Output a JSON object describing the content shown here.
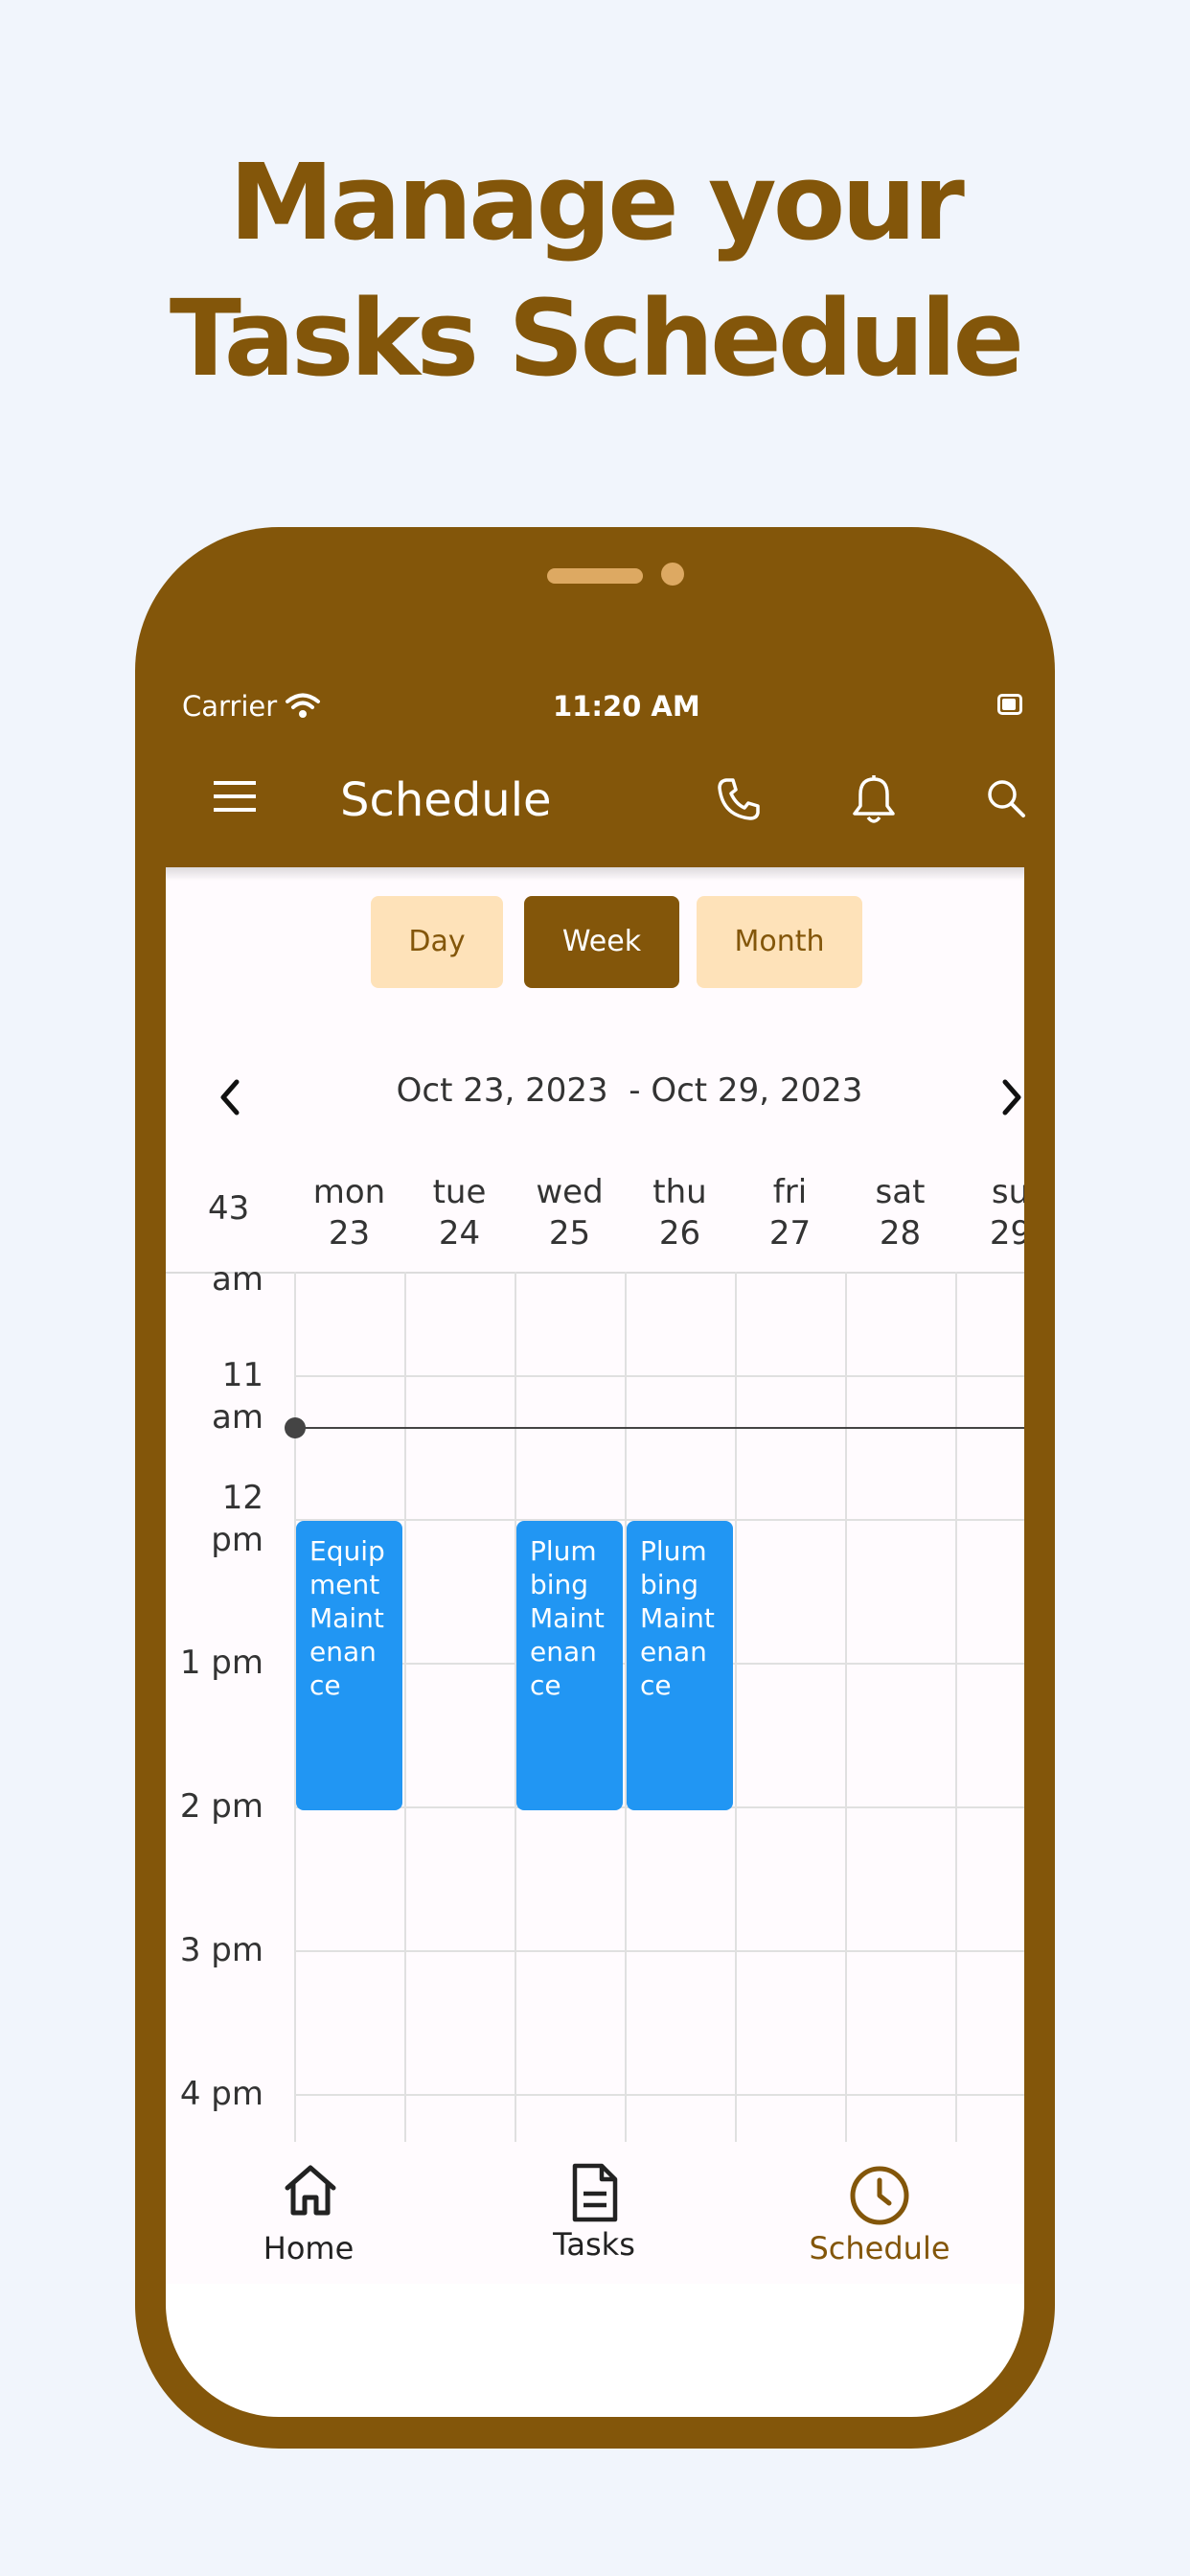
{
  "headline": {
    "line1": "Manage your",
    "line2": "Tasks Schedule"
  },
  "colors": {
    "brand": "#83560a",
    "segment_inactive": "#fee2b9",
    "event": "#2196f3",
    "background": "#f1f5fc"
  },
  "status_bar": {
    "carrier": "Carrier",
    "time": "11:20 AM"
  },
  "app_bar": {
    "title": "Schedule",
    "icons": [
      "menu-icon",
      "phone-icon",
      "bell-icon",
      "search-icon"
    ]
  },
  "view_switch": {
    "day": "Day",
    "week": "Week",
    "month": "Month",
    "selected": "Week"
  },
  "date_range": {
    "start": "Oct 23, 2023",
    "end": "- Oct 29, 2023"
  },
  "calendar": {
    "week_number": "43",
    "days": [
      {
        "name": "mon",
        "date": "23"
      },
      {
        "name": "tue",
        "date": "24"
      },
      {
        "name": "wed",
        "date": "25"
      },
      {
        "name": "thu",
        "date": "26"
      },
      {
        "name": "fri",
        "date": "27"
      },
      {
        "name": "sat",
        "date": "28"
      },
      {
        "name": "su",
        "date": "29"
      }
    ],
    "time_labels": [
      "am",
      "11 am",
      "12\npm",
      "1 pm",
      "2 pm",
      "3 pm",
      "4 pm"
    ],
    "events": [
      {
        "title": "Equipment Maintenance",
        "day": "mon"
      },
      {
        "title": "Plumbing Maintenance",
        "day": "wed"
      },
      {
        "title": "Plumbing Maintenance",
        "day": "thu"
      }
    ]
  },
  "bottom_nav": {
    "items": [
      {
        "label": "Home",
        "icon": "home-icon"
      },
      {
        "label": "Tasks",
        "icon": "document-icon"
      },
      {
        "label": "Schedule",
        "icon": "clock-icon",
        "active": true
      }
    ]
  }
}
